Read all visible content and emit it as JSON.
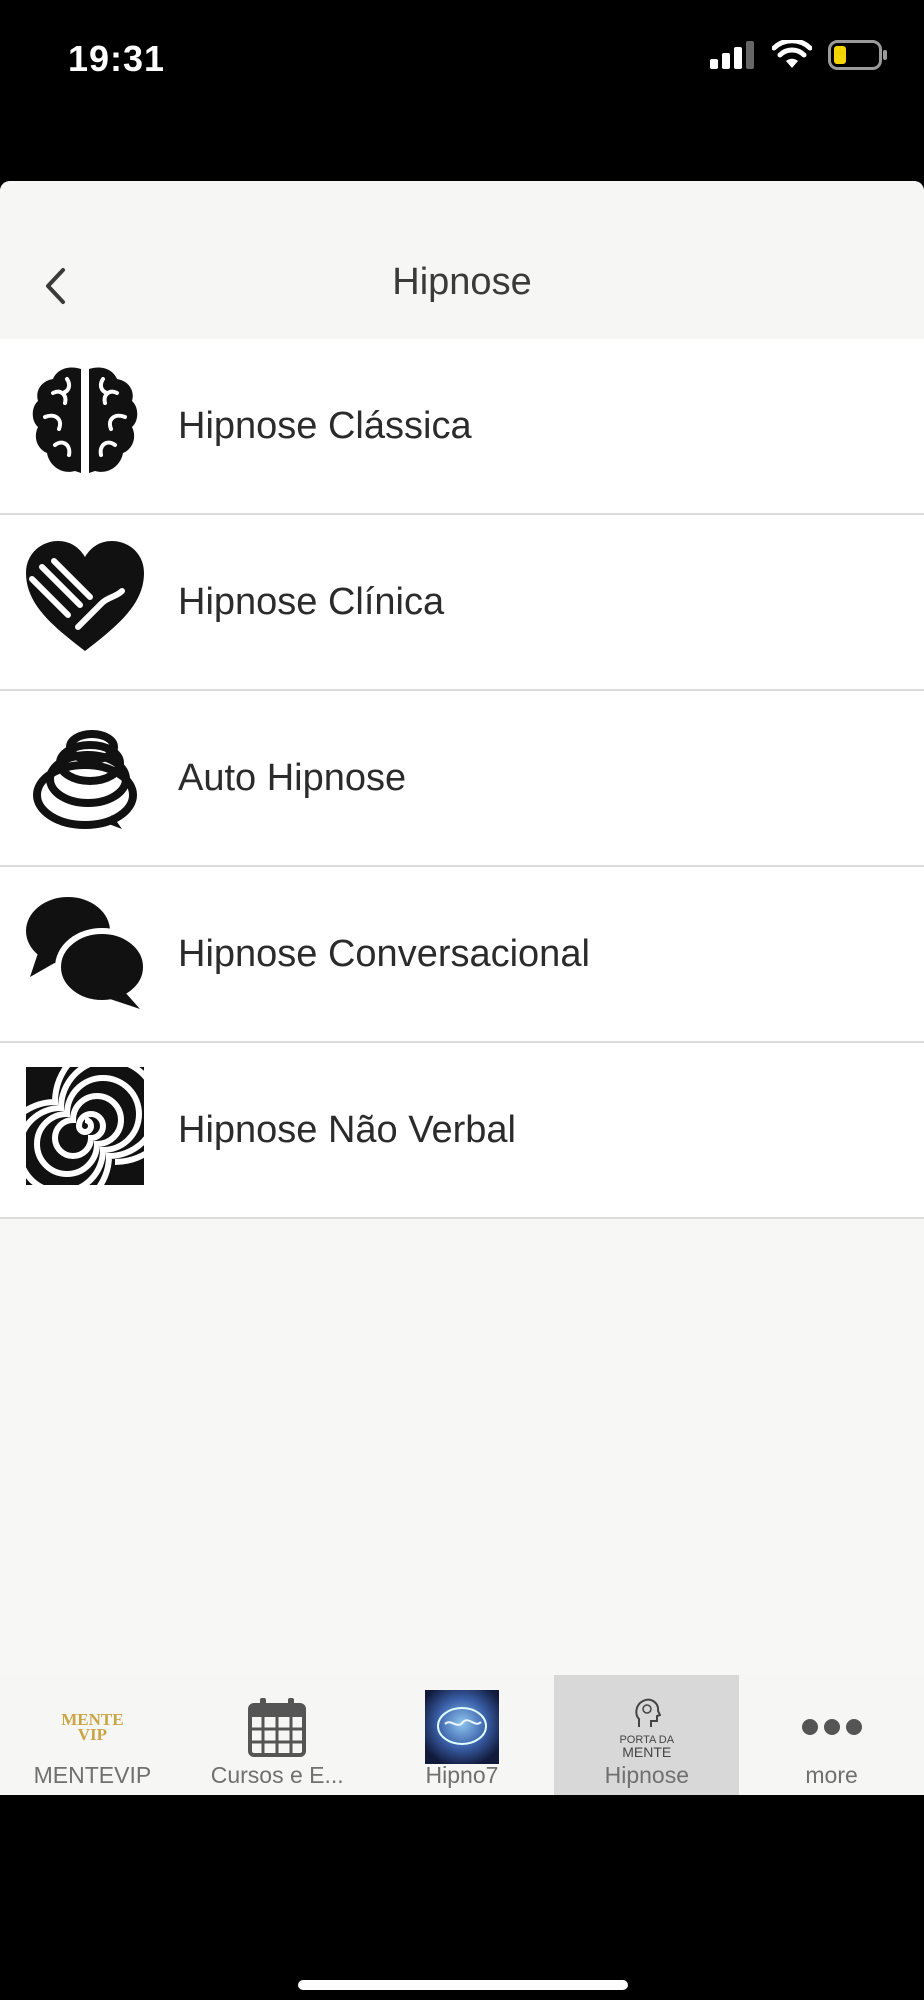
{
  "status_bar": {
    "time": "19:31",
    "battery_color": "#f5d500"
  },
  "nav": {
    "title": "Hipnose",
    "back_icon": "chevron-left-icon"
  },
  "menu_items": [
    {
      "label": "Hipnose Clássica",
      "icon": "brain-icon"
    },
    {
      "label": "Hipnose Clínica",
      "icon": "heart-hands-icon"
    },
    {
      "label": "Auto Hipnose",
      "icon": "spiral-coil-icon"
    },
    {
      "label": "Hipnose Conversacional",
      "icon": "speech-bubbles-icon"
    },
    {
      "label": "Hipnose Não Verbal",
      "icon": "hypno-spiral-icon"
    }
  ],
  "tabs": [
    {
      "label": "MENTEVIP",
      "icon": "mentevip-logo",
      "logo_line1": "MENTE",
      "logo_line2": "VIP"
    },
    {
      "label": "Cursos e E...",
      "icon": "calendar-icon"
    },
    {
      "label": "Hipno7",
      "icon": "hipno7-logo"
    },
    {
      "label": "Hipnose",
      "icon": "porta-da-mente-logo",
      "active": true,
      "logo_line1": "PORTA DA",
      "logo_line2": "MENTE"
    },
    {
      "label": "more",
      "icon": "more-dots-icon"
    }
  ],
  "colors": {
    "active_tab_bg": "#d8d8d8",
    "logo_gold": "#c9a545"
  }
}
